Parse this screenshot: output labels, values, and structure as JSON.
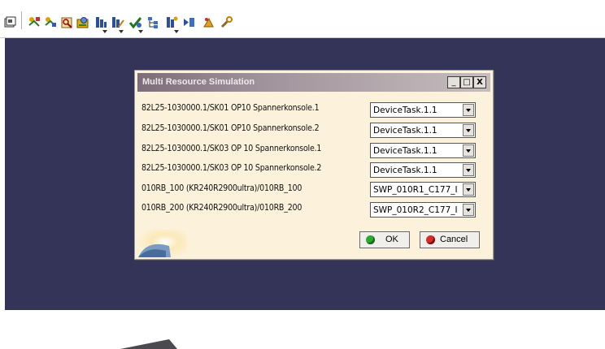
{
  "toolbar": {
    "icons": [
      "box-icon",
      "catalog-icon",
      "catalog-browser-icon",
      "analysis-icon",
      "analysis-folder-icon",
      "sequence-icon",
      "sequence-edit-icon",
      "check-icon",
      "tree-icon",
      "process-icon",
      "simulation-run-icon",
      "tools-icon",
      "wrench-icon"
    ]
  },
  "dialog": {
    "title": "Multi Resource Simulation",
    "min_label": "_",
    "max_label": "□",
    "close_label": "X",
    "rows": [
      {
        "label": "82L25-1030000.1/SK01 OP10 Spannerkonsole.1",
        "value": "DeviceTask.1.1"
      },
      {
        "label": "82L25-1030000.1/SK01 OP10 Spannerkonsole.2",
        "value": "DeviceTask.1.1"
      },
      {
        "label": "82L25-1030000.1/SK03 OP 10 Spannerkonsole.1",
        "value": "DeviceTask.1.1"
      },
      {
        "label": "82L25-1030000.1/SK03 OP 10 Spannerkonsole.2",
        "value": "DeviceTask.1.1"
      },
      {
        "label": "010RB_100 (KR240R2900ultra)/010RB_100",
        "value": "SWP_010R1_C177_I"
      },
      {
        "label": "010RB_200 (KR240R2900ultra)/010RB_200",
        "value": "SWP_010R2_C177_I"
      }
    ],
    "ok_label": "OK",
    "cancel_label": "Cancel"
  },
  "colors": {
    "viewport_bg": "#343459",
    "dialog_bg": "#fcf2dc",
    "ok_icon": "#2fa82f",
    "cancel_icon": "#d82c2c"
  }
}
